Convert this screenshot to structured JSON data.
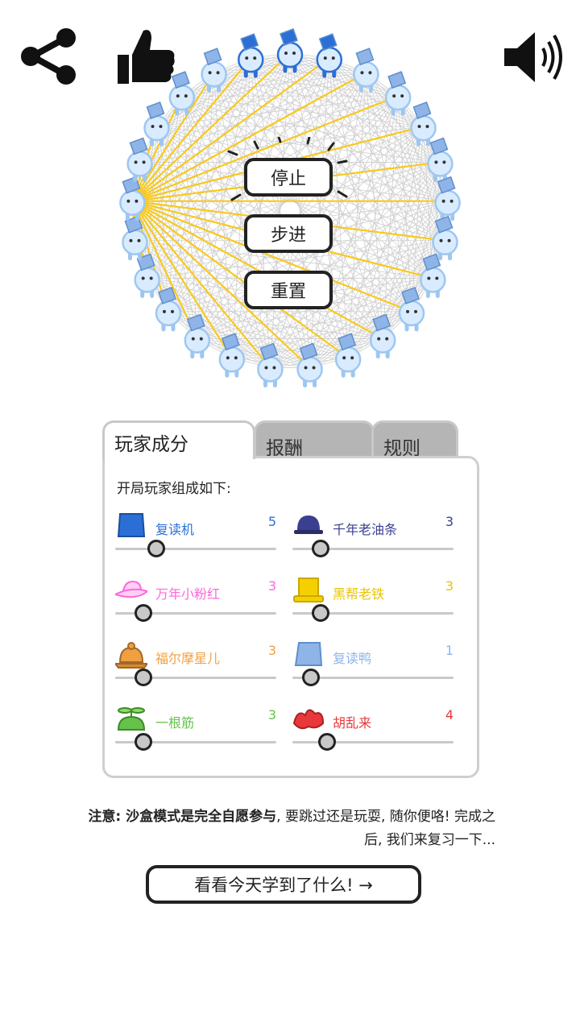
{
  "toolbar": {
    "share_icon": "share-icon",
    "like_icon": "thumbs-up-icon",
    "sound_icon": "speaker-icon"
  },
  "controls": {
    "stop_label": "停止",
    "step_label": "步进",
    "reset_label": "重置"
  },
  "tabs": [
    {
      "label": "玩家成分",
      "active": true
    },
    {
      "label": "报酬",
      "active": false
    },
    {
      "label": "规则",
      "active": false
    }
  ],
  "panel": {
    "intro": "开局玩家组成如下:",
    "player_types": [
      {
        "name": "复读机",
        "count": "5",
        "color": "#2b6fd6",
        "hat": "blue-bucket-hat-icon",
        "slider_fraction": 0.2
      },
      {
        "name": "千年老油条",
        "count": "3",
        "color": "#3a3f8f",
        "hat": "dark-bowler-hat-icon",
        "slider_fraction": 0.12
      },
      {
        "name": "万年小粉红",
        "count": "3",
        "color": "#ff66dd",
        "hat": "pink-sun-hat-icon",
        "slider_fraction": 0.12
      },
      {
        "name": "黑帮老铁",
        "count": "3",
        "color": "#e8c400",
        "hat": "yellow-top-hat-icon",
        "slider_fraction": 0.12
      },
      {
        "name": "福尔摩星儿",
        "count": "3",
        "color": "#f0a040",
        "hat": "deerstalker-hat-icon",
        "slider_fraction": 0.12
      },
      {
        "name": "复读鸭",
        "count": "1",
        "color": "#8fb4e8",
        "hat": "light-blue-bucket-hat-icon",
        "slider_fraction": 0.06
      },
      {
        "name": "一根筋",
        "count": "3",
        "color": "#66c24a",
        "hat": "propeller-cap-icon",
        "slider_fraction": 0.12
      },
      {
        "name": "胡乱来",
        "count": "4",
        "color": "#e8383a",
        "hat": "red-jester-hat-icon",
        "slider_fraction": 0.16
      }
    ]
  },
  "note": {
    "bold": "注意: 沙盒模式是完全自愿参与",
    "rest": ", 要跳过还是玩耍, 随你便咯! 完成之后, 我们来复习一下..."
  },
  "next_button_label": "看看今天学到了什么! →",
  "simulation": {
    "player_count": 25,
    "highlighted_player_index": 19,
    "colors": {
      "player_body": "#d9ecff",
      "player_outline": "#9ec7f0",
      "hat_light": "#8fb4e8",
      "hat_dark": "#2b6fd6",
      "active_lines": "#f8c91c",
      "mesh_lines": "#cfcfcf"
    }
  }
}
